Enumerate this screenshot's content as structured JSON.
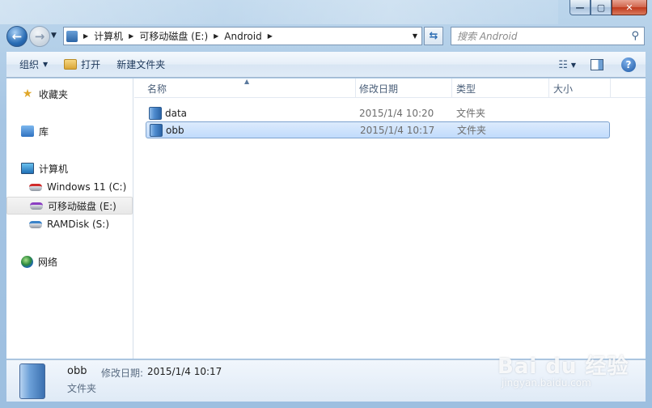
{
  "window": {
    "minimize_label": "—",
    "maximize_label": "▢",
    "close_label": "✕"
  },
  "nav": {
    "back_glyph": "←",
    "forward_glyph": "→",
    "breadcrumb": [
      "计算机",
      "可移动磁盘 (E:)",
      "Android"
    ],
    "search_placeholder": "搜索 Android"
  },
  "toolbar": {
    "organize_label": "组织",
    "open_label": "打开",
    "new_folder_label": "新建文件夹",
    "help_label": "?"
  },
  "sidebar": {
    "favorites": "收藏夹",
    "libraries": "库",
    "computer": "计算机",
    "drives": [
      {
        "label": "Windows 11 (C:)"
      },
      {
        "label": "可移动磁盘 (E:)"
      },
      {
        "label": "RAMDisk (S:)"
      }
    ],
    "network": "网络"
  },
  "columns": {
    "name": "名称",
    "date": "修改日期",
    "type": "类型",
    "size": "大小"
  },
  "files": [
    {
      "name": "data",
      "date": "2015/1/4 10:20",
      "type": "文件夹",
      "selected": false
    },
    {
      "name": "obb",
      "date": "2015/1/4 10:17",
      "type": "文件夹",
      "selected": true
    }
  ],
  "details": {
    "name": "obb",
    "date_label": "修改日期:",
    "date_value": "2015/1/4 10:17",
    "type": "文件夹"
  },
  "watermark": {
    "logo_text": "Bai du 经验",
    "url": "jingyan.baidu.com"
  }
}
